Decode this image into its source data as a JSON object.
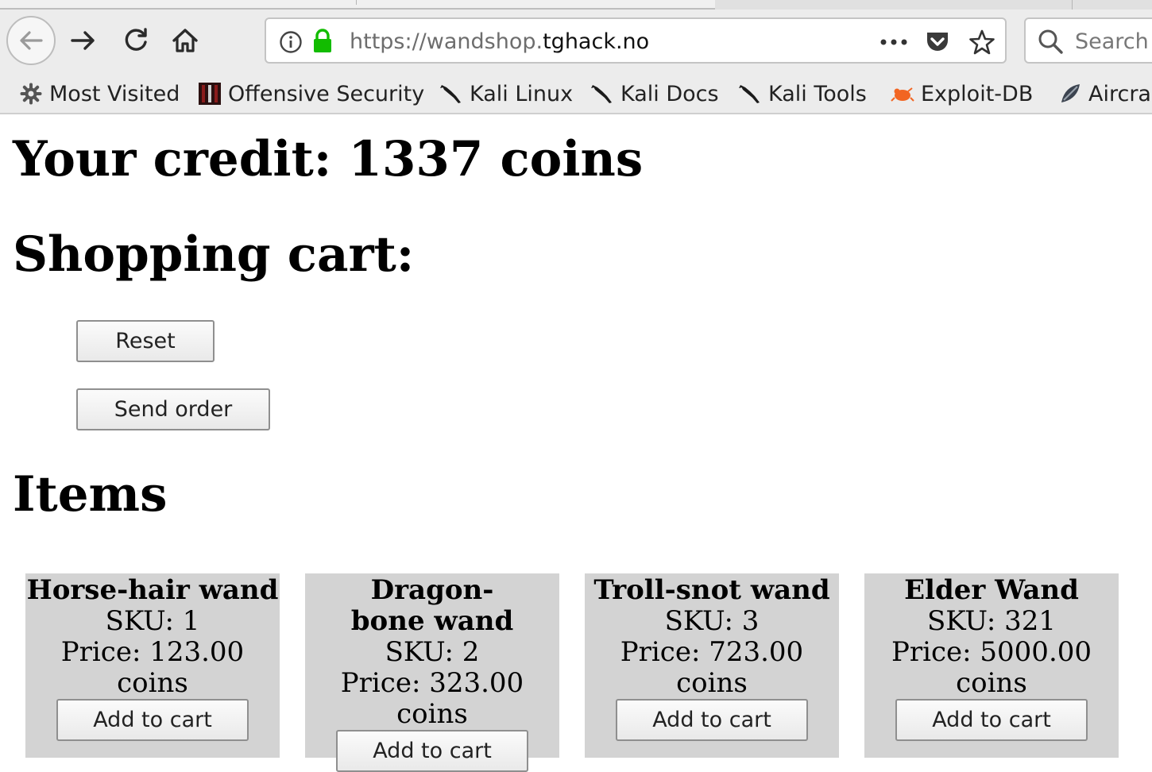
{
  "browser": {
    "url_scheme": "https://",
    "url_subdomain": "wandshop.",
    "url_domain": "tghack.no",
    "search_placeholder": "Search",
    "bookmarks": [
      {
        "label": "Most Visited",
        "icon": "gear-icon"
      },
      {
        "label": "Offensive Security",
        "icon": "offensive-security-icon"
      },
      {
        "label": "Kali Linux",
        "icon": "kali-dragon-icon"
      },
      {
        "label": "Kali Docs",
        "icon": "kali-dragon-icon"
      },
      {
        "label": "Kali Tools",
        "icon": "kali-dragon-icon"
      },
      {
        "label": "Exploit-DB",
        "icon": "exploit-db-icon"
      },
      {
        "label": "Aircra",
        "icon": "aircrack-icon"
      }
    ]
  },
  "page": {
    "credit_heading": "Your credit: 1337 coins",
    "cart_heading": "Shopping cart:",
    "reset_label": "Reset",
    "send_order_label": "Send order",
    "items_heading": "Items",
    "items": [
      {
        "name": "Horse-hair wand",
        "sku": "SKU: 1",
        "price": "Price: 123.00 coins",
        "button": "Add to cart"
      },
      {
        "name": "Dragon-bone wand",
        "sku": "SKU: 2",
        "price": "Price: 323.00 coins",
        "button": "Add to cart"
      },
      {
        "name": "Troll-snot wand",
        "sku": "SKU: 3",
        "price": "Price: 723.00 coins",
        "button": "Add to cart"
      },
      {
        "name": "Elder Wand",
        "sku": "SKU: 321",
        "price": "Price: 5000.00 coins",
        "button": "Add to cart"
      }
    ]
  },
  "colors": {
    "lock_green": "#12bc00",
    "card_background": "#d3d3d3",
    "exploit_db_orange": "#f26522"
  }
}
